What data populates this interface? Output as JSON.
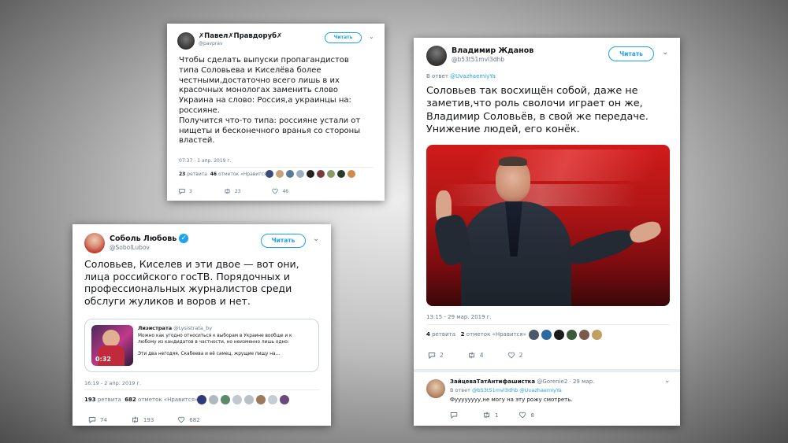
{
  "colors": {
    "accent": "#1da1f2",
    "muted": "#657786",
    "text": "#14171a"
  },
  "tweet_pavel": {
    "author_name": "✗Павел✗Правдоруб✗",
    "author_handle": "@pavprav",
    "follow_label": "Читать",
    "text": "Чтобы сделать выпуски пропагандистов\nтипа Соловьева и Киселёва более\nчестными,достаточно всего лишь в их\nкрасочных монологах заменить слово\nУкраина на слово: Россия,а украинцы на:\nроссияне.\nПолучится что-то типа: россияне устали от\nнищеты и бесконечного вранья со стороны\nвластей.",
    "timestamp": "07:37 - 1 апр. 2019 г.",
    "retweets_count": "23",
    "retweets_label": "ретвита",
    "likes_count": "46",
    "likes_label": "отметок «Нравится»",
    "replies": "3",
    "retweets": "23",
    "likes": "46"
  },
  "tweet_sobol": {
    "author_name": "Соболь Любовь",
    "author_handle": "@SobolLubov",
    "follow_label": "Читать",
    "text": "Соловьев, Киселев и эти двое — вот они,\nлица российского госТВ. Порядочных и\nпрофессиональных журналистов среди\nобслуги жуликов и воров и нет.",
    "quote": {
      "author_name": "Лизистрата",
      "author_handle": "@Lysistrata_by",
      "text": "Можно как угодно относиться к выборам в Украине вообще и к\nлюбому из кандидатов в частности, но неизменно лишь одно:\n\nЭти два негодяя, Скабеева и её самец, жрущие пищу на...",
      "video_duration": "0:32"
    },
    "timestamp": "16:19 - 2 апр. 2019 г.",
    "retweets_count": "193",
    "retweets_label": "ретвита",
    "likes_count": "682",
    "likes_label": "отметок «Нравится»",
    "replies": "74",
    "retweets": "193",
    "likes": "682"
  },
  "tweet_zhdanov": {
    "author_name": "Владимир Жданов",
    "author_handle": "@b53t51mvl3dhb",
    "follow_label": "Читать",
    "reply_prefix": "В ответ",
    "reply_handle": "@UvazhaemiyYa",
    "text": "Соловьев так восхищён собой, даже не\nзаметив,что роль сволочи играет он же,\nВладимир Соловьёв, в свой же передаче.\nУнижение людей, его конёк.",
    "timestamp": "13:15 - 29 мар. 2019 г.",
    "retweets_count": "4",
    "retweets_label": "ретвита",
    "likes_count": "2",
    "likes_label": "отметок «Нравится»",
    "replies": "2",
    "retweets": "4",
    "likes": "2",
    "reply": {
      "author_name": "ЗайцеваТатАнтифашистка",
      "author_handle": "@Gorenie2",
      "date": "· 29 мар.",
      "reply_prefix": "В ответ",
      "reply_handles": "@b53t51mvl3dhb @UvazhaemiyYa",
      "text": "Фуууууууу,не могу на эту рожу смотреть.",
      "replies": "",
      "retweets": "1",
      "likes": "8"
    }
  }
}
